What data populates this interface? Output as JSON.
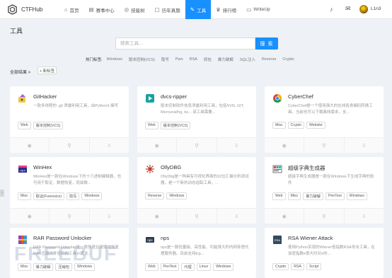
{
  "header": {
    "brand": "CTFHub",
    "nav": [
      {
        "icon": "⌂",
        "icon_name": "home-icon",
        "label": "首页"
      },
      {
        "icon": "▤",
        "icon_name": "calendar-icon",
        "label": "赛事中心"
      },
      {
        "icon": "◎",
        "icon_name": "skill-tree-icon",
        "label": "技能树"
      },
      {
        "icon": "▢",
        "icon_name": "history-icon",
        "label": "历年真题"
      },
      {
        "icon": "✎",
        "icon_name": "tools-icon",
        "label": "工具",
        "active": true
      },
      {
        "icon": "♛",
        "icon_name": "trophy-icon",
        "label": "排行榜"
      },
      {
        "icon": "▭",
        "icon_name": "writeup-icon",
        "label": "WriteUp"
      }
    ],
    "bell_icon": "♪",
    "mail_icon": "✉",
    "username": "L1n3"
  },
  "page": {
    "title": "工具",
    "search_placeholder": "搜索工具...",
    "search_button": "搜 索",
    "hot_tags_label": "热门标签:",
    "hot_tags": [
      "Windows",
      "版本控制(VCS)",
      "隐写",
      "Pwn",
      "RSA",
      "抓包",
      "暴力破解",
      "SQL注入",
      "Reverse",
      "Crypto"
    ],
    "results_label": "全部结果 >",
    "reset_label": "+ 新标签"
  },
  "footer_icons": {
    "view": "◉",
    "link": "⚲",
    "download": "⇩"
  },
  "accent_color": "#1890ff",
  "cards": [
    {
      "name": "GitHacker",
      "icon": "githacker-icon",
      "desc": "一款多线程的 .git 泄露利用工具，由Python3 编写",
      "tags": [
        "Web",
        "版本控制(VCS)"
      ]
    },
    {
      "name": "dvcs-ripper",
      "icon": "dvcs-ripper-icon",
      "desc": "版本控制软件信息泄露利用工具，包括SVN, GIT, Mercurial/hg, bz... 该工具需要...",
      "tags": [
        "Web",
        "版本控制(VCS)"
      ]
    },
    {
      "name": "CyberChef",
      "icon": "cyberchef-icon",
      "desc": "CyberChef是一个使用强大的在线各类编码转换工具，当前也可以下载离线版本，支...",
      "tags": [
        "Misc",
        "Crypto",
        "Website"
      ]
    },
    {
      "name": "WinHex",
      "icon": "winhex-icon",
      "desc": "WinHex是一款在Windows下的十六进制编辑器，也可用于取证、数据恢复，低级数...",
      "tags": [
        "Misc",
        "取证(Forensics)",
        "隐写",
        "Windows"
      ]
    },
    {
      "name": "OllyDBG",
      "icon": "ollydbg-icon",
      "desc": "OllyDbg是一种具有可视化界面的32位汇编分析调试器，是一个新的动态追踪工具，...",
      "tags": [
        "Reverse",
        "Windows"
      ]
    },
    {
      "name": "超级字典生成器",
      "icon": "dictionary-generator-icon",
      "desc": "超级字典生成器是一款在Windows下生成字典的软件",
      "tags": [
        "Web",
        "Misc",
        "暴力破解",
        "PenTest",
        "Windows"
      ]
    },
    {
      "name": "RAR Password Unlocker",
      "icon": "rar-unlocker-icon",
      "desc": "RAR Password Unlocker是一款快速且便捷地恢复RAR压缩文件密码的工具，其支...",
      "tags": [
        "Misc",
        "暴力破解",
        "压缩包",
        "Windows"
      ]
    },
    {
      "name": "nps",
      "icon": "nps-icon",
      "desc": "nps是一款轻量级、高性能、功能强大的内网穿透代理服务器。目前支持tcp...",
      "tags": [
        "Web",
        "PenTest",
        "代理",
        "Linux",
        "Windows"
      ]
    },
    {
      "name": "RSA Wiener Attack",
      "icon": "rsa-wiener-icon",
      "desc": "使用Python实现的Wiener低指数RSA攻击工具，在加密指数e很大时对e的...",
      "tags": [
        "Crypto",
        "RSA",
        "Script"
      ]
    }
  ],
  "watermark": "FREEBUF"
}
